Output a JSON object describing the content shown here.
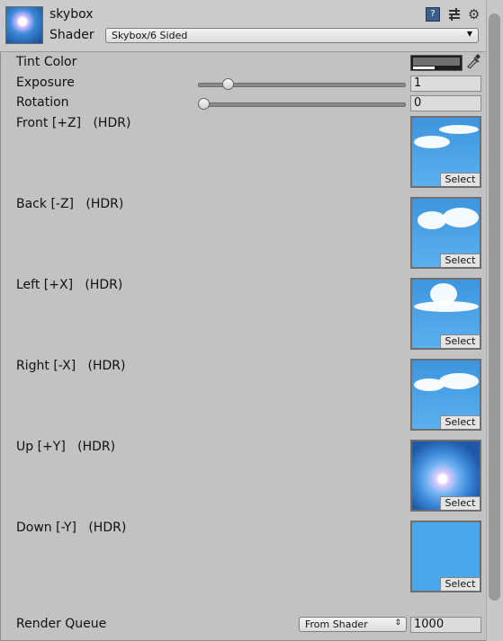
{
  "header": {
    "material_name": "skybox",
    "shader_label": "Shader",
    "shader_value": "Skybox/6 Sided",
    "help_icon": "help-book-icon",
    "presets_icon": "presets-sliders-icon",
    "settings_icon": "gear-icon"
  },
  "properties": {
    "tint_color": {
      "label": "Tint Color"
    },
    "exposure": {
      "label": "Exposure",
      "value": "1",
      "slider_fraction": 0.125
    },
    "rotation": {
      "label": "Rotation",
      "value": "0",
      "slider_fraction": 0.0
    }
  },
  "textures": [
    {
      "label": "Front [+Z]   (HDR)",
      "button": "Select"
    },
    {
      "label": "Back [-Z]   (HDR)",
      "button": "Select"
    },
    {
      "label": "Left [+X]   (HDR)",
      "button": "Select"
    },
    {
      "label": "Right [-X]   (HDR)",
      "button": "Select"
    },
    {
      "label": "Up [+Y]   (HDR)",
      "button": "Select"
    },
    {
      "label": "Down [-Y]   (HDR)",
      "button": "Select"
    }
  ],
  "render_queue": {
    "label": "Render Queue",
    "mode": "From Shader",
    "value": "1000"
  },
  "colors": {
    "panel_bg": "#c2c2c2",
    "sky_blue": "#4aa3e6"
  }
}
